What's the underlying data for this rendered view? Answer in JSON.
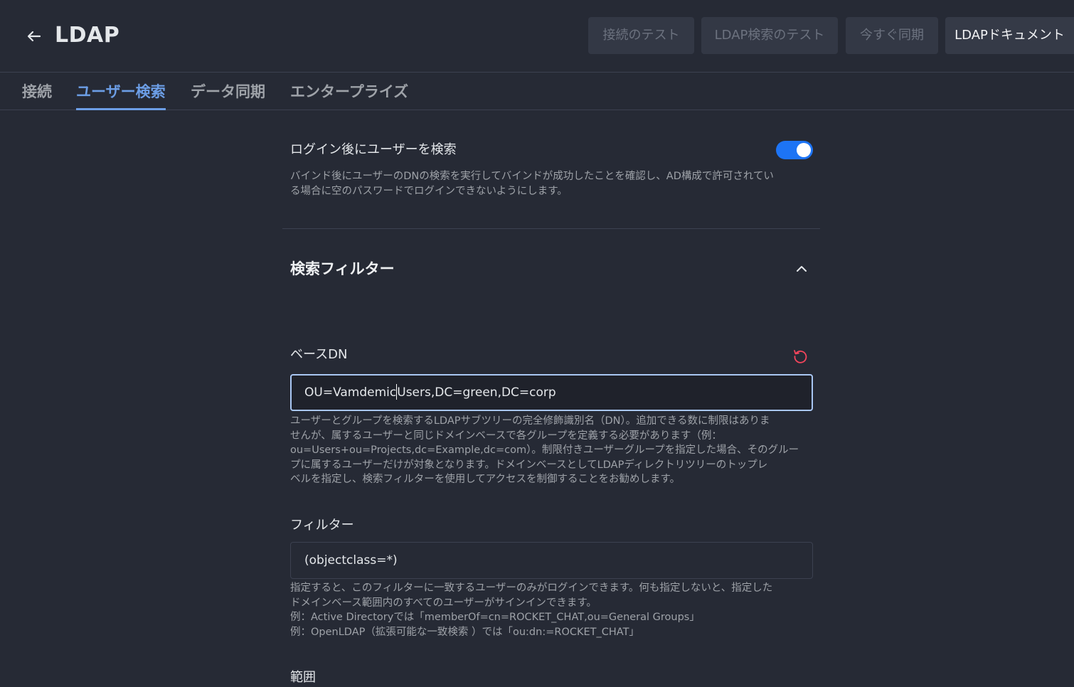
{
  "header": {
    "back_icon": "arrow-left-icon",
    "title": "LDAP",
    "buttons": {
      "test_connection": "接続のテスト",
      "test_search": "LDAP検索のテスト",
      "sync_now": "今すぐ同期",
      "docs": "LDAPドキュメント"
    }
  },
  "tabs": {
    "connection": "接続",
    "user_search": "ユーザー検索",
    "data_sync": "データ同期",
    "enterprise": "エンタープライズ"
  },
  "search_after_login": {
    "label": "ログイン後にユーザーを検索",
    "enabled": true,
    "description_line1": "バインド後にユーザーのDNの検索を実行してバインドが成功したことを確認し、AD構成で許可されてい",
    "description_line2": "る場合に空のパスワードでログインできないようにします。"
  },
  "search_filter_section": {
    "title": "検索フィルター",
    "expanded": true
  },
  "base_dn": {
    "label": "ベースDN",
    "reset_icon": "reset-icon",
    "value_before_caret": "OU=Vamdemic",
    "value_after_caret": "Users,DC=green,DC=corp",
    "desc_line1": "ユーザーとグループを検索するLDAPサブツリーの完全修飾識別名（DN）。追加できる数に制限はありま",
    "desc_line2": "せんが、属するユーザーと同じドメインベースで各グループを定義する必要があります（例：",
    "desc_line3": "ou=Users+ou=Projects,dc=Example,dc=com）。制限付きユーザーグループを指定した場合、そのグルー",
    "desc_line4": "プに属するユーザーだけが対象となります。ドメインベースとしてLDAPディレクトリツリーのトップレ",
    "desc_line5": "ベルを指定し、検索フィルターを使用してアクセスを制御することをお勧めします。"
  },
  "filter": {
    "label": "フィルター",
    "value": "(objectclass=*)",
    "desc_line1": "指定すると、このフィルターに一致するユーザーのみがログインできます。何も指定しないと、指定した",
    "desc_line2": "ドメインベース範囲内のすべてのユーザーがサインインできます。",
    "desc_line3": "例：Active Directoryでは「memberOf=cn=ROCKET_CHAT,ou=General Groups」",
    "desc_line4": "例：OpenLDAP（拡張可能な一致検索 ）では「ou:dn:=ROCKET_CHAT」"
  },
  "scope": {
    "label": "範囲"
  },
  "colors": {
    "background": "#262a35",
    "accent": "#6c9ee6",
    "toggle_on": "#1d74f5",
    "reset_icon": "#f5455c"
  }
}
